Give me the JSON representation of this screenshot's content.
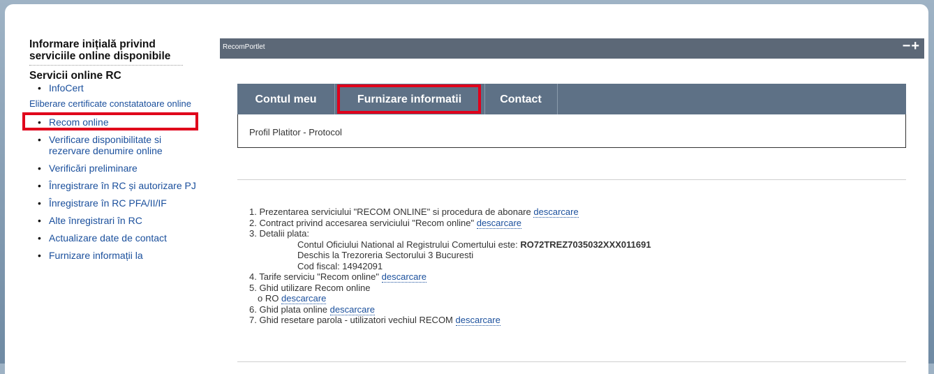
{
  "sidebar": {
    "heading": "Informare inițială privind serviciile online disponibile",
    "section_title": "Servicii online RC",
    "infocert": "InfoCert",
    "eliberare": "Eliberare certificate constatatoare online",
    "items": [
      "Recom online",
      "Verificare disponibilitate si rezervare denumire online",
      "Verificări preliminare",
      "Înregistrare în RC și autorizare PJ",
      "Înregistrare în RC PFA/II/IF",
      "Alte înregistrari în RC",
      "Actualizare date de contact",
      "Furnizare informații la"
    ]
  },
  "portlet": {
    "title": "RecomPortlet",
    "controls": "−+"
  },
  "tabs": [
    "Contul meu",
    "Furnizare informatii",
    "Contact"
  ],
  "subnav": "Profil Platitor - Protocol",
  "content": {
    "item1_text": "1. Prezentarea serviciului \"RECOM ONLINE\" si procedura de abonare",
    "item2_text": "2. Contract privind accesarea serviciului \"Recom online\"",
    "item3_text": "3. Detalii plata:",
    "account_prefix": "Contul Oficiului National al Registrului Comertului este:",
    "account_number": "RO72TREZ7035032XXX011691",
    "bank": "Deschis la Trezoreria Sectorului 3 Bucuresti",
    "fiscal": "Cod fiscal: 14942091",
    "item4_text": "4. Tarife serviciu \"Recom online\"",
    "item5_text": "5. Ghid utilizare Recom online",
    "item5_sub": "RO",
    "item6_text": "6. Ghid plata online",
    "item7_text": "7. Ghid resetare parola - utilizatori vechiul RECOM",
    "link_label": "descarcare",
    "sub_bullet": "o"
  }
}
